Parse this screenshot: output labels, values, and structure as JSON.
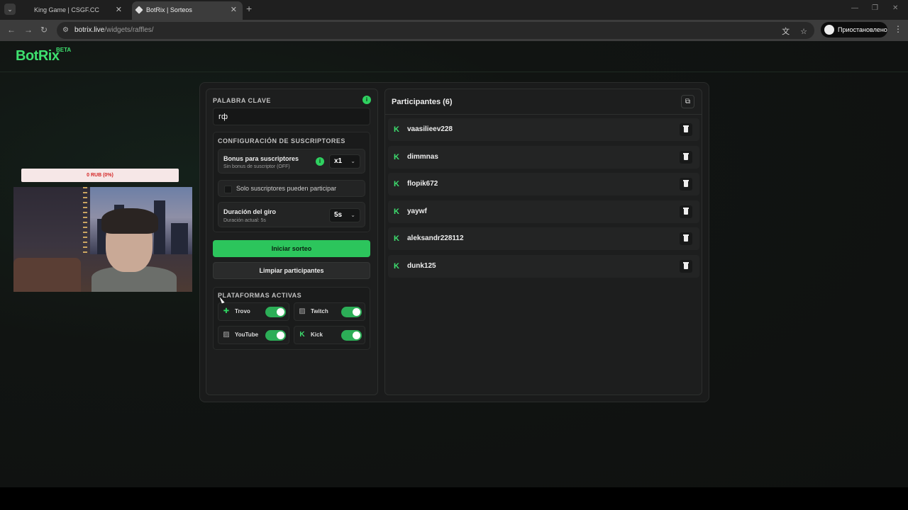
{
  "browser": {
    "tabs": [
      {
        "title": "King Game | CSGF.CC",
        "active": false
      },
      {
        "title": "BotRix | Sorteos",
        "active": true
      }
    ],
    "url_host": "botrix.live",
    "url_path": "/widgets/raffles/",
    "profile_label": "Приостановлено"
  },
  "brand": {
    "logo": "BotRix",
    "badge": "BETA",
    "accent": "#3ee06f"
  },
  "stream_overlay": {
    "progress_text": "0 RUB (0%)",
    "progress": 0
  },
  "keyword": {
    "label": "PALABRA CLAVE",
    "value": "гф"
  },
  "subscribers": {
    "label": "CONFIGURACIÓN DE SUSCRIPTORES",
    "bonus_title": "Bonus para suscriptores",
    "bonus_sub": "Sin bonus de suscriptor (OFF)",
    "bonus_value": "x1",
    "only_subs_label": "Solo suscriptores pueden participar",
    "only_subs_checked": false,
    "spin_title": "Duración del giro",
    "spin_sub": "Duración actual: 5s",
    "spin_value": "5s"
  },
  "actions": {
    "start": "Iniciar sorteo",
    "clear": "Limpiar participantes"
  },
  "platforms": {
    "label": "PLATAFORMAS ACTIVAS",
    "items": [
      {
        "name": "Trovo",
        "icon": "trovo-icon",
        "enabled": true
      },
      {
        "name": "Twitch",
        "icon": "twitch-icon",
        "enabled": true
      },
      {
        "name": "YouTube",
        "icon": "youtube-icon",
        "enabled": true
      },
      {
        "name": "Kick",
        "icon": "kick-icon",
        "enabled": true
      }
    ]
  },
  "participants": {
    "title": "Participantes (6)",
    "items": [
      "vaasilieev228",
      "dimmnas",
      "flopik672",
      "yaywf",
      "aleksandr228112",
      "dunk125"
    ]
  }
}
